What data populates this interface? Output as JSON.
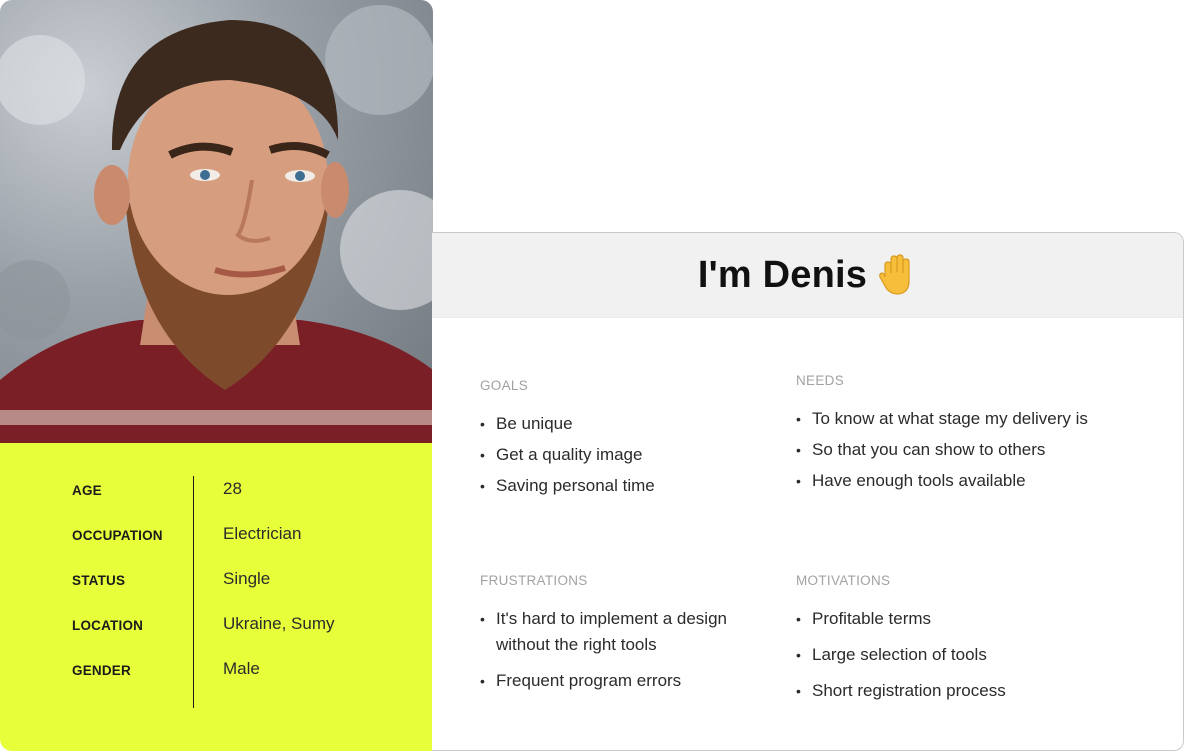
{
  "profile": {
    "photo": {
      "icon": "portrait-photo"
    },
    "rows": [
      {
        "label": "AGE",
        "value": "28"
      },
      {
        "label": "OCCUPATION",
        "value": "Electrician"
      },
      {
        "label": "STATUS",
        "value": "Single"
      },
      {
        "label": "LOCATION",
        "value": "Ukraine, Sumy"
      },
      {
        "label": "GENDER",
        "value": "Male"
      }
    ],
    "accent_color": "#e6ff3a"
  },
  "card": {
    "title": "I'm Denis",
    "title_icon": "raised-hand-icon",
    "header_bg": "#f1f1f1",
    "goals": {
      "title": "GOALS",
      "items": [
        "Be unique",
        "Get a quality image",
        "Saving personal time"
      ]
    },
    "needs": {
      "title": "NEEDS",
      "items": [
        "To know at what stage my delivery is",
        "So that you can show to others",
        "Have enough tools available"
      ]
    },
    "frustrations": {
      "title": "FRUSTRATIONS",
      "items": [
        "It's hard to implement a design without the right tools",
        "Frequent program errors"
      ]
    },
    "motivations": {
      "title": "MOTIVATIONS",
      "items": [
        "Profitable terms",
        "Large selection of tools",
        "Short registration process"
      ]
    }
  }
}
